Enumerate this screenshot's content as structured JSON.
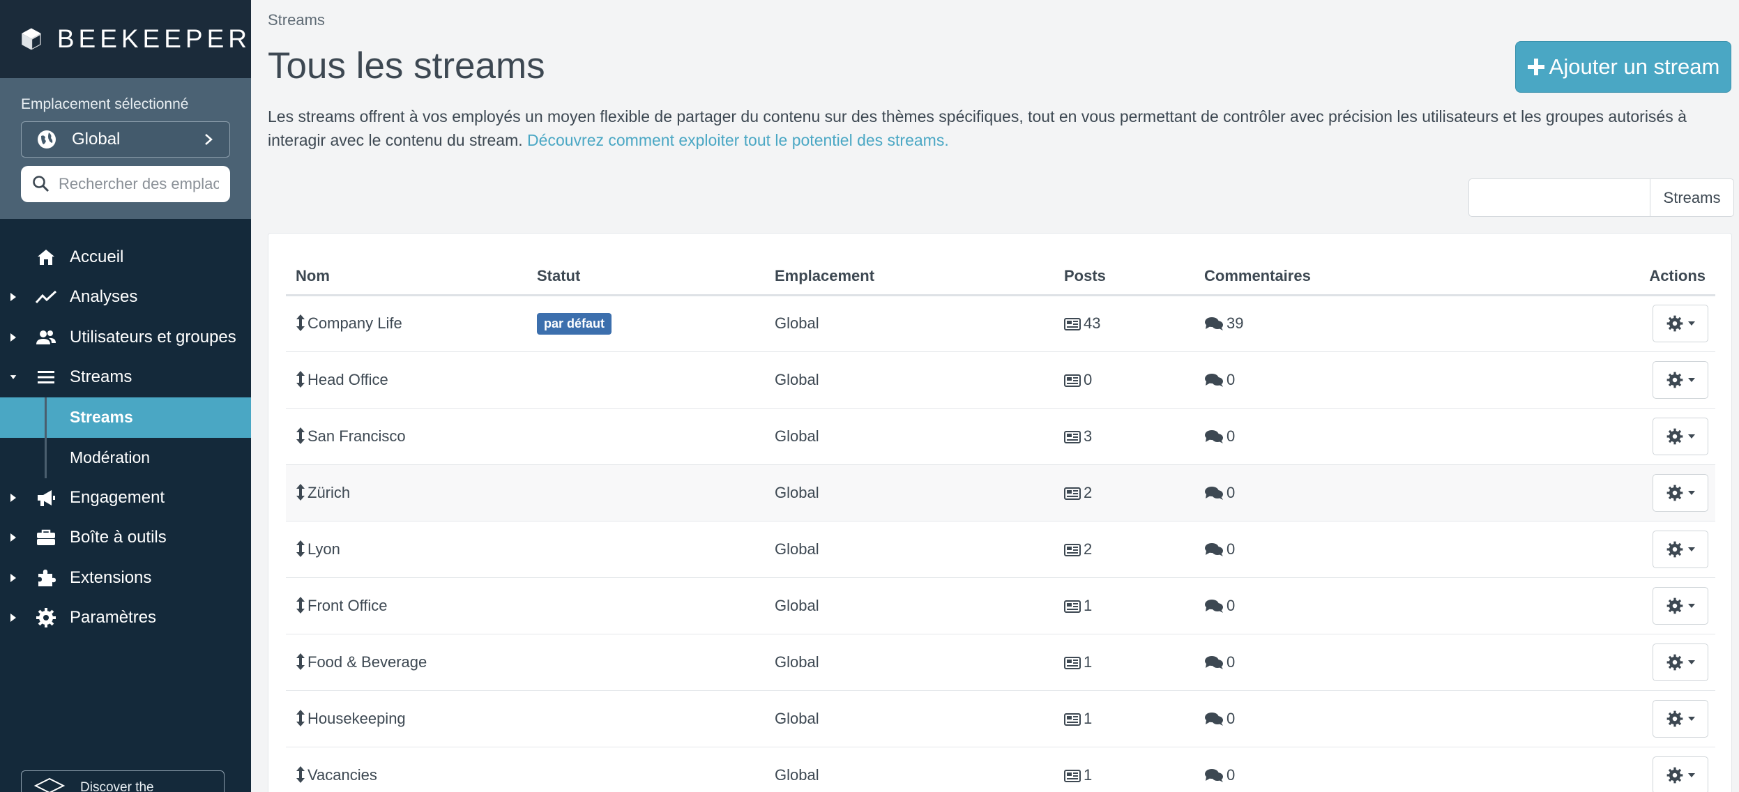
{
  "app": {
    "brand": "BEEKEEPER"
  },
  "location": {
    "label": "Emplacement sélectionné",
    "selected": "Global",
    "search_placeholder": "Rechercher des emplacements"
  },
  "nav": {
    "items": [
      {
        "label": "Accueil",
        "icon": "home-icon"
      },
      {
        "label": "Analyses",
        "icon": "chart-line-icon"
      },
      {
        "label": "Utilisateurs et groupes",
        "icon": "users-icon"
      },
      {
        "label": "Streams",
        "icon": "list-icon"
      },
      {
        "label": "Engagement",
        "icon": "megaphone-icon"
      },
      {
        "label": "Boîte à outils",
        "icon": "toolbox-icon"
      },
      {
        "label": "Extensions",
        "icon": "puzzle-icon"
      },
      {
        "label": "Paramètres",
        "icon": "gear-icon"
      }
    ],
    "sub_items": [
      {
        "label": "Streams",
        "active": true
      },
      {
        "label": "Modération",
        "active": false
      }
    ],
    "discover": "Discover the"
  },
  "page": {
    "breadcrumb": "Streams",
    "title": "Tous les streams",
    "add_button": "Ajouter un stream",
    "description": "Les streams offrent à vos employés un moyen flexible de partager du contenu sur des thèmes spécifiques, tout en vous permettant de contrôler avec précision les utilisateurs et les groupes autorisés à interagir avec le contenu du stream.",
    "description_link": "Découvrez comment exploiter tout le potentiel des streams.",
    "search_value": "",
    "search_button": "Streams"
  },
  "table": {
    "headers": {
      "name": "Nom",
      "status": "Statut",
      "location": "Emplacement",
      "posts": "Posts",
      "comments": "Commentaires",
      "actions": "Actions"
    },
    "rows": [
      {
        "name": "Company Life",
        "status": "par défaut",
        "location": "Global",
        "posts": "43",
        "comments": "39"
      },
      {
        "name": "Head Office",
        "status": "",
        "location": "Global",
        "posts": "0",
        "comments": "0"
      },
      {
        "name": "San Francisco",
        "status": "",
        "location": "Global",
        "posts": "3",
        "comments": "0"
      },
      {
        "name": "Zürich",
        "status": "",
        "location": "Global",
        "posts": "2",
        "comments": "0"
      },
      {
        "name": "Lyon",
        "status": "",
        "location": "Global",
        "posts": "2",
        "comments": "0"
      },
      {
        "name": "Front Office",
        "status": "",
        "location": "Global",
        "posts": "1",
        "comments": "0"
      },
      {
        "name": "Food & Beverage",
        "status": "",
        "location": "Global",
        "posts": "1",
        "comments": "0"
      },
      {
        "name": "Housekeeping",
        "status": "",
        "location": "Global",
        "posts": "1",
        "comments": "0"
      },
      {
        "name": "Vacancies",
        "status": "",
        "location": "Global",
        "posts": "1",
        "comments": "0"
      }
    ]
  },
  "colors": {
    "sidebar_bg": "#14293a",
    "location_panel_bg": "#4b6274",
    "accent": "#4aa7c4",
    "badge": "#3c6fad"
  }
}
